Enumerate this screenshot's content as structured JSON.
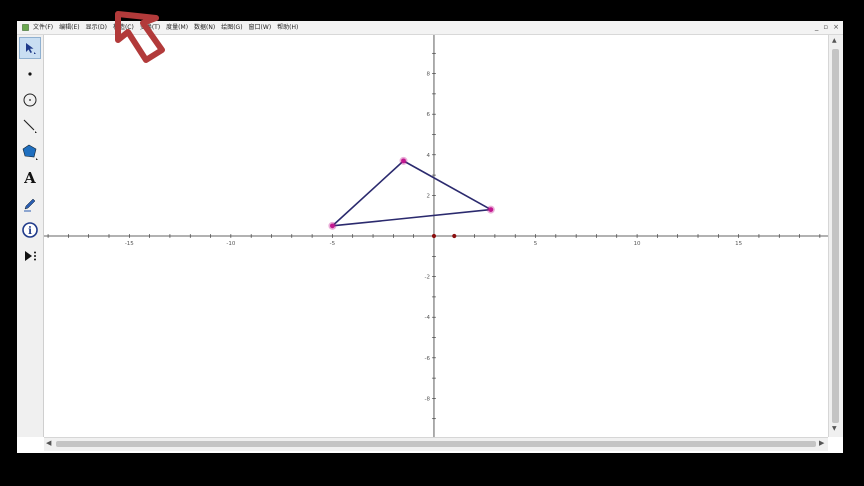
{
  "menubar": {
    "items": [
      "文件(F)",
      "编辑(E)",
      "显示(D)",
      "构造(C)",
      "变换(T)",
      "度量(M)",
      "数据(N)",
      "绘图(G)",
      "窗口(W)",
      "帮助(H)"
    ],
    "window_controls": [
      "_",
      "▫",
      "×"
    ]
  },
  "toolbox": {
    "tools": [
      {
        "name": "arrow-select-tool",
        "icon": "arrow-icon",
        "active": true
      },
      {
        "name": "point-tool",
        "icon": "point-icon"
      },
      {
        "name": "compass-tool",
        "icon": "circle-icon"
      },
      {
        "name": "straightedge-tool",
        "icon": "line-icon"
      },
      {
        "name": "polygon-tool",
        "icon": "polygon-icon"
      },
      {
        "name": "text-tool",
        "icon": "text-A-icon",
        "glyph": "A"
      },
      {
        "name": "marker-tool",
        "icon": "pencil-icon"
      },
      {
        "name": "information-tool",
        "icon": "info-icon",
        "glyph": "i"
      },
      {
        "name": "custom-tool",
        "icon": "play-menu-icon"
      }
    ]
  },
  "graph": {
    "x_ticks": [
      -15,
      -10,
      -5,
      5,
      10,
      15
    ],
    "y_ticks": [
      8,
      6,
      4,
      2,
      -2,
      -4,
      -6,
      -8
    ],
    "xlim": [
      -19.2,
      19.4
    ],
    "ylim": [
      -9.9,
      9.9
    ],
    "triangle": [
      [
        -5,
        0.5
      ],
      [
        -1.5,
        3.7
      ],
      [
        2.8,
        1.3
      ]
    ],
    "origin_points": [
      [
        0,
        0
      ],
      [
        1,
        0
      ]
    ],
    "colors": {
      "polygon": "#2b2a6e",
      "vertex": "#c2188f",
      "origin_point": "#8b1010",
      "axis": "#333333"
    }
  },
  "annotation": {
    "icon": "pointer-arrow-icon",
    "color": "#b23a3a"
  }
}
